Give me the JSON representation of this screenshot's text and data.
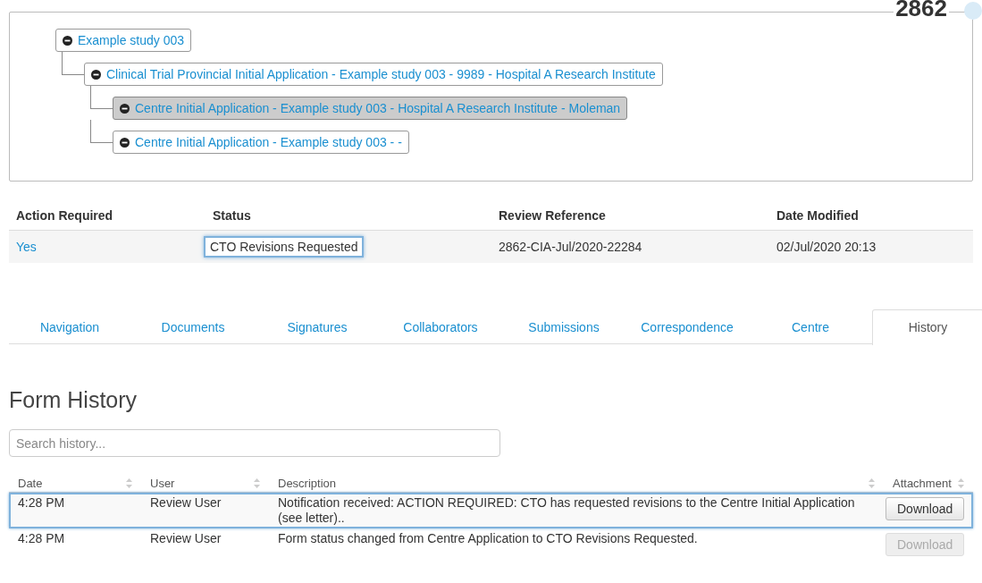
{
  "header": {
    "number": "2862"
  },
  "tree": [
    {
      "label": "Example study 003",
      "expanded": true,
      "selected": false,
      "children": [
        {
          "label": "Clinical Trial Provincial Initial Application - Example study 003 - 9989 - Hospital A Research Institute",
          "expanded": true,
          "selected": false,
          "children": [
            {
              "label": "Centre Initial Application - Example study 003 - Hospital A Research Institute - Moleman",
              "expanded": true,
              "selected": true
            },
            {
              "label": "Centre Initial Application - Example study 003 - -",
              "expanded": true,
              "selected": false
            }
          ]
        }
      ]
    }
  ],
  "summary": {
    "columns": [
      "Action Required",
      "Status",
      "Review Reference",
      "Date Modified"
    ],
    "row": {
      "action_required": "Yes",
      "status": "CTO Revisions Requested",
      "status_highlighted": true,
      "review_reference": "2862-CIA-Jul/2020-22284",
      "date_modified": "02/Jul/2020 20:13"
    }
  },
  "tabs": [
    {
      "label": "Navigation",
      "selected": false
    },
    {
      "label": "Documents",
      "selected": false
    },
    {
      "label": "Signatures",
      "selected": false
    },
    {
      "label": "Collaborators",
      "selected": false
    },
    {
      "label": "Submissions",
      "selected": false
    },
    {
      "label": "Correspondence",
      "selected": false
    },
    {
      "label": "Centre",
      "selected": false
    },
    {
      "label": "History",
      "selected": true
    }
  ],
  "history": {
    "title": "Form History",
    "search": {
      "placeholder": "Search history..."
    },
    "columns": [
      "Date",
      "User",
      "Description",
      "Attachment"
    ],
    "rows": [
      {
        "date": "4:28 PM",
        "user": "Review User",
        "description": "Notification received: ACTION REQUIRED: CTO has requested revisions to the Centre Initial Application (see letter)..",
        "button": "Download",
        "disabled": false,
        "highlighted": true
      },
      {
        "date": "4:28 PM",
        "user": "Review User",
        "description": "Form status changed from Centre Application to CTO Revisions Requested.",
        "button": "Download",
        "disabled": true,
        "highlighted": false
      }
    ]
  }
}
